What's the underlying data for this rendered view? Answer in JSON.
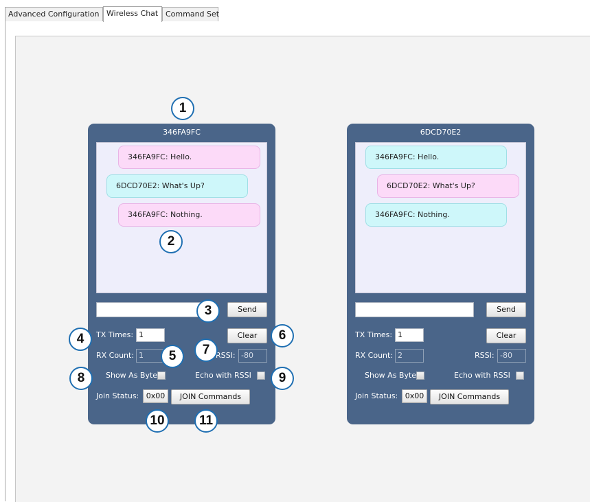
{
  "tabs": [
    {
      "label": "Advanced Configuration",
      "active": false
    },
    {
      "label": "Wireless Chat",
      "active": true
    },
    {
      "label": "Command Set",
      "active": false
    }
  ],
  "panels": [
    {
      "title": "346FA9FC",
      "messages": [
        {
          "text": "346FA9FC: Hello.",
          "color": "pink"
        },
        {
          "text": "6DCD70E2: What's Up?",
          "color": "cyan"
        },
        {
          "text": "346FA9FC: Nothing.",
          "color": "pink"
        }
      ],
      "message_input": "",
      "send_label": "Send",
      "tx_times_label": "TX Times:",
      "tx_times_value": "1",
      "clear_label": "Clear",
      "rx_count_label": "RX Count:",
      "rx_count_value": "1",
      "rssi_label": "RSSI:",
      "rssi_value": "-80",
      "show_as_bytes_label": "Show As Bytes",
      "show_as_bytes_checked": false,
      "echo_rssi_label": "Echo with RSSI",
      "echo_rssi_checked": false,
      "join_status_label": "Join Status:",
      "join_status_value": "0x00",
      "join_commands_label": "JOIN Commands"
    },
    {
      "title": "6DCD70E2",
      "messages": [
        {
          "text": "346FA9FC: Hello.",
          "color": "cyan"
        },
        {
          "text": "6DCD70E2: What's Up?",
          "color": "pink"
        },
        {
          "text": "346FA9FC: Nothing.",
          "color": "cyan"
        }
      ],
      "message_input": "",
      "send_label": "Send",
      "tx_times_label": "TX Times:",
      "tx_times_value": "1",
      "clear_label": "Clear",
      "rx_count_label": "RX Count:",
      "rx_count_value": "2",
      "rssi_label": "RSSI:",
      "rssi_value": "-80",
      "show_as_bytes_label": "Show As Bytes",
      "show_as_bytes_checked": false,
      "echo_rssi_label": "Echo with RSSI",
      "echo_rssi_checked": false,
      "join_status_label": "Join Status:",
      "join_status_value": "0x00",
      "join_commands_label": "JOIN Commands"
    }
  ],
  "callouts": [
    "1",
    "2",
    "3",
    "4",
    "5",
    "6",
    "7",
    "8",
    "9",
    "10",
    "11"
  ],
  "colors": {
    "panel_bg": "#4a6589",
    "chat_bg": "#eeeefb",
    "bubble_pink": "#fcdaf8",
    "bubble_cyan": "#cef7fa",
    "callout_border": "#1f6fb2",
    "canvas_bg": "#f3f3f3"
  }
}
